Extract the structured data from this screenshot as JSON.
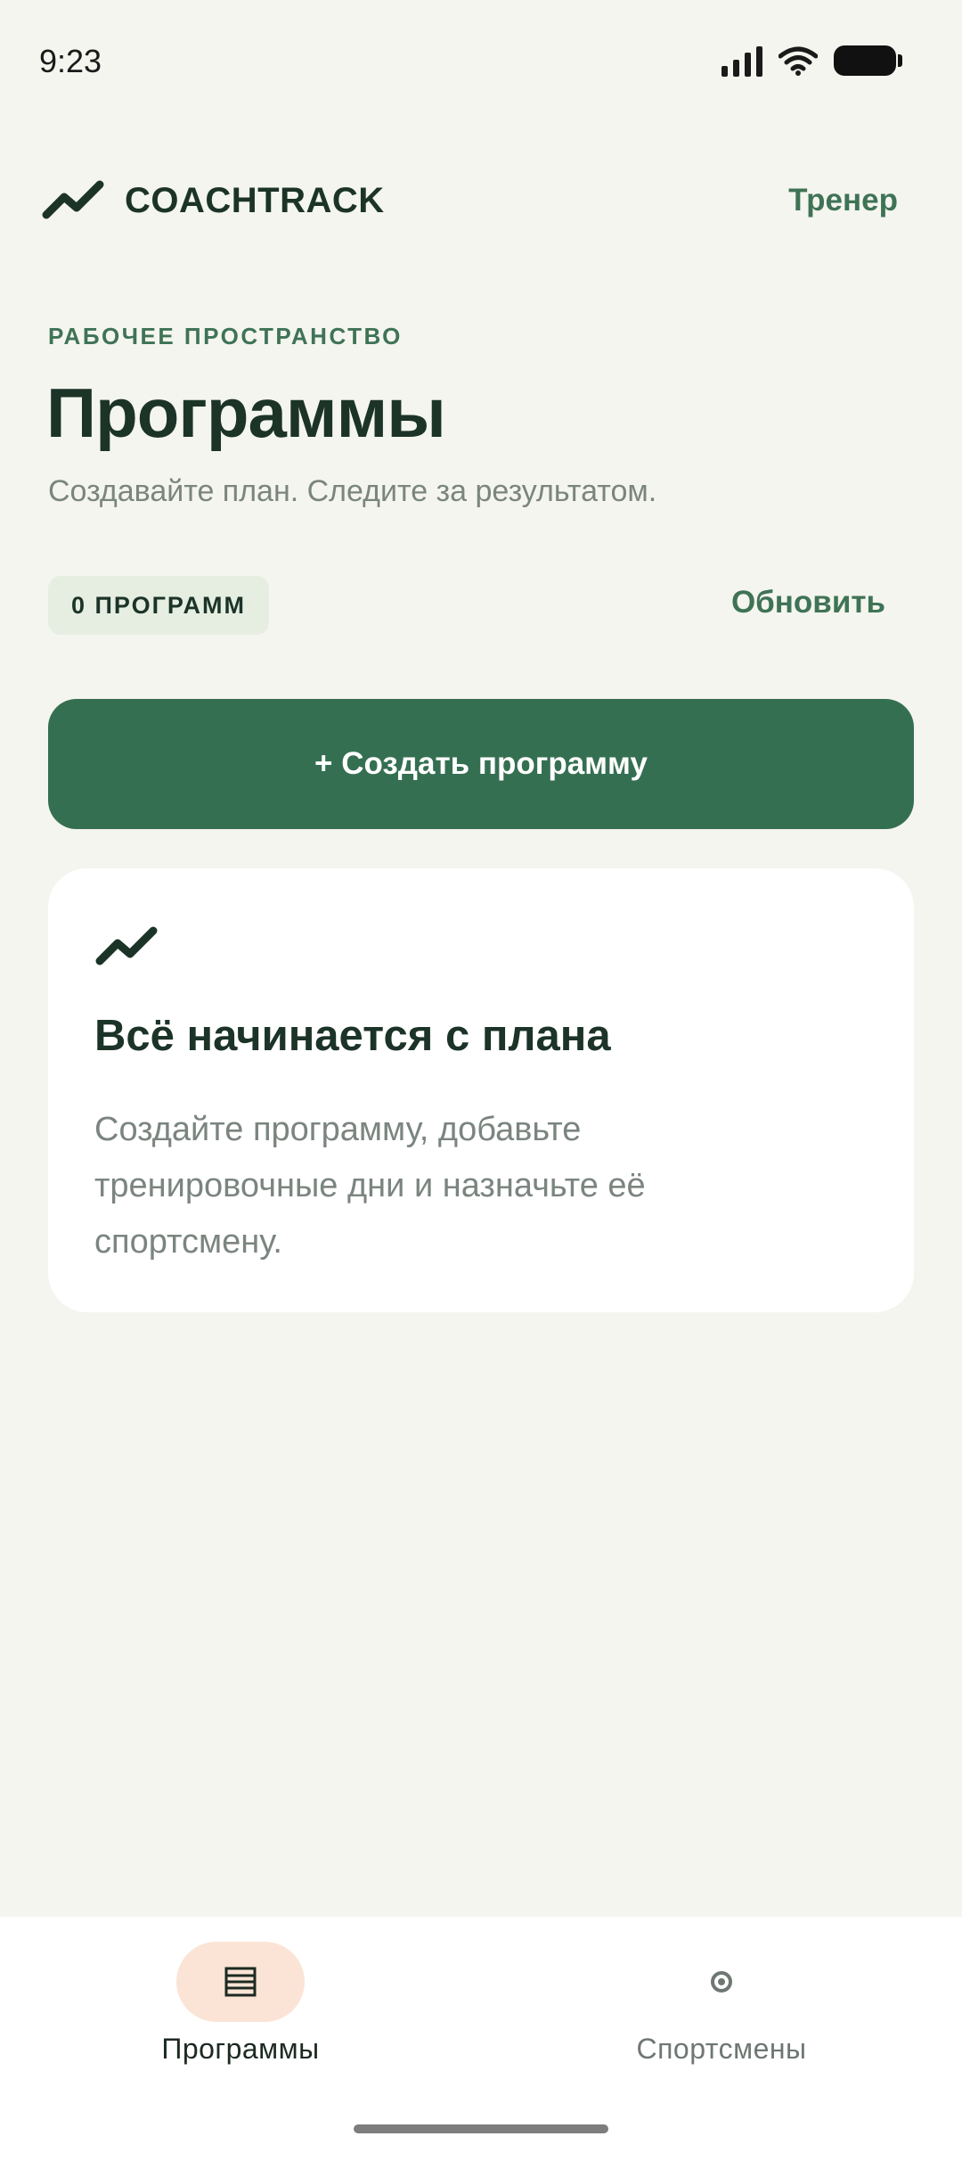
{
  "status_bar": {
    "time": "9:23"
  },
  "header": {
    "brand_name": "COACHTRACK",
    "role_link": "Тренер"
  },
  "workspace": {
    "label": "РАБОЧЕЕ ПРОСТРАНСТВО",
    "title": "Программы",
    "subtitle": "Создавайте план. Следите за результатом."
  },
  "programs": {
    "count_badge": "0 ПРОГРАММ",
    "refresh_label": "Обновить"
  },
  "create_button": {
    "label": "+ Создать программу"
  },
  "empty_state": {
    "title": "Всё начинается с плана",
    "text": "Создайте программу, добавьте тренировочные дни и назначьте её спортсмену."
  },
  "bottom_nav": {
    "items": [
      {
        "label": "Программы",
        "icon": "list-icon",
        "active": true
      },
      {
        "label": "Спортсмены",
        "icon": "target-icon",
        "active": false
      }
    ]
  },
  "colors": {
    "background": "#f4f5ee",
    "accent": "#356f52",
    "text_dark": "#1c3328",
    "muted": "#7b857f",
    "active_pill": "#fbe4d6"
  }
}
